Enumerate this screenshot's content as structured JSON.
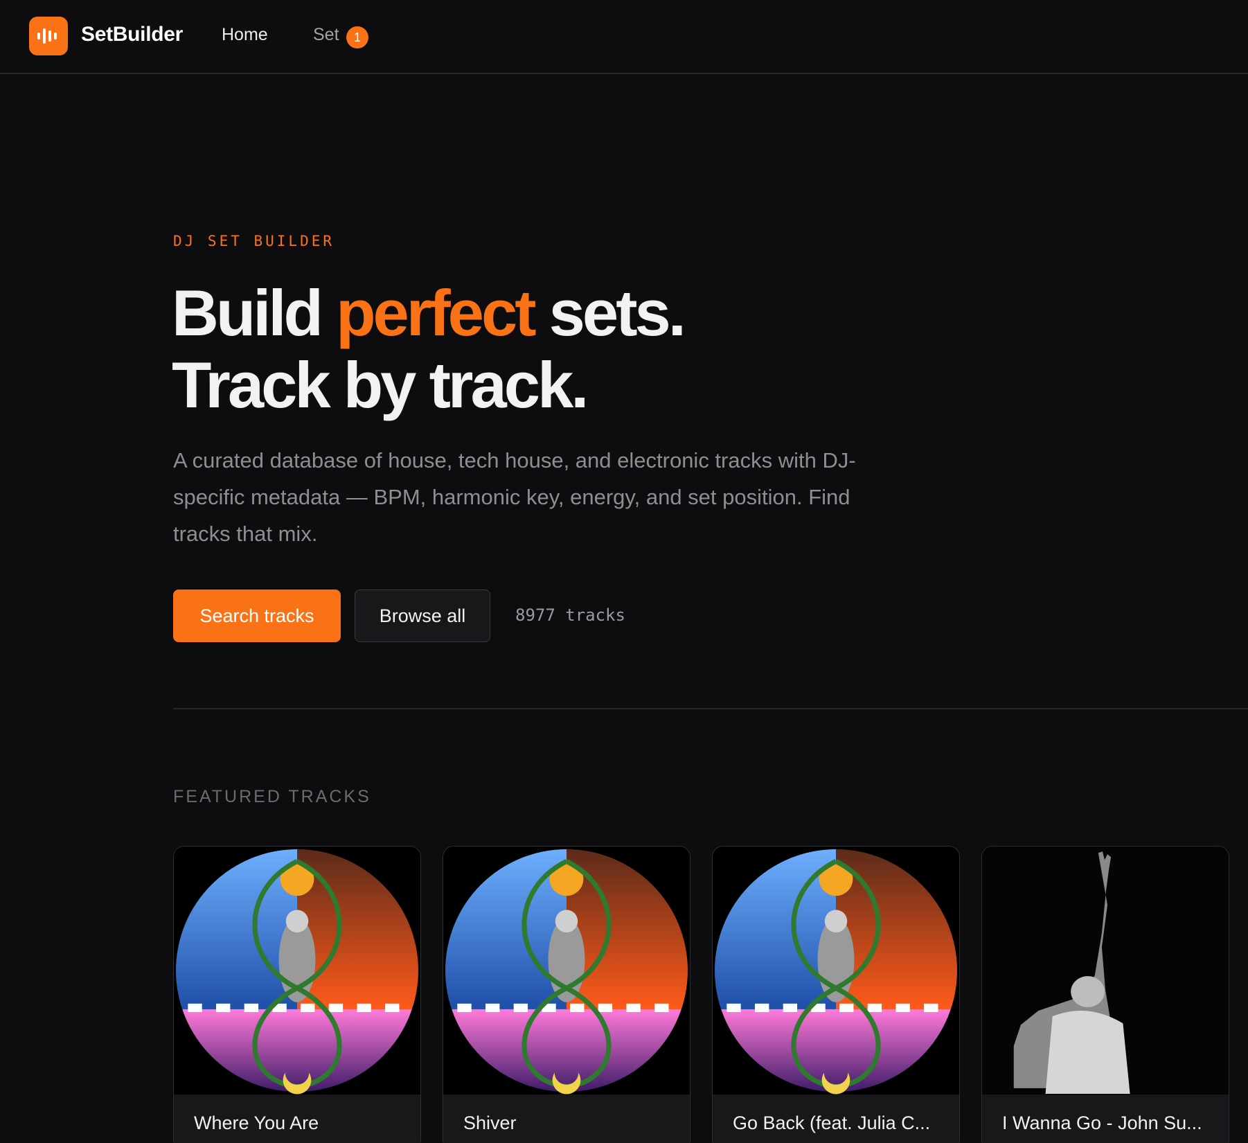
{
  "nav": {
    "brand": "SetBuilder",
    "home_label": "Home",
    "set_label": "Set",
    "set_count": "1"
  },
  "hero": {
    "eyebrow": "DJ SET BUILDER",
    "headline_pre": "Build ",
    "headline_accent": "perfect",
    "headline_post": " sets.",
    "headline_line2": "Track by track.",
    "description": "A curated database of house, tech house, and electronic tracks with DJ-specific metadata — BPM, harmonic key, energy, and set position. Find tracks that mix.",
    "search_button": "Search tracks",
    "browse_button": "Browse all",
    "track_count": "8977 tracks"
  },
  "featured": {
    "title": "FEATURED TRACKS",
    "tracks": [
      {
        "title": "Where You Are",
        "art": "mandala-artwork"
      },
      {
        "title": "Shiver",
        "art": "mandala-artwork"
      },
      {
        "title": "Go Back (feat. Julia C...",
        "art": "mandala-artwork"
      },
      {
        "title": "I Wanna Go - John Su...",
        "art": "monochrome-photo"
      }
    ]
  },
  "colors": {
    "accent": "#f97316",
    "background": "#0d0d0f",
    "card_body": "#18181b"
  }
}
